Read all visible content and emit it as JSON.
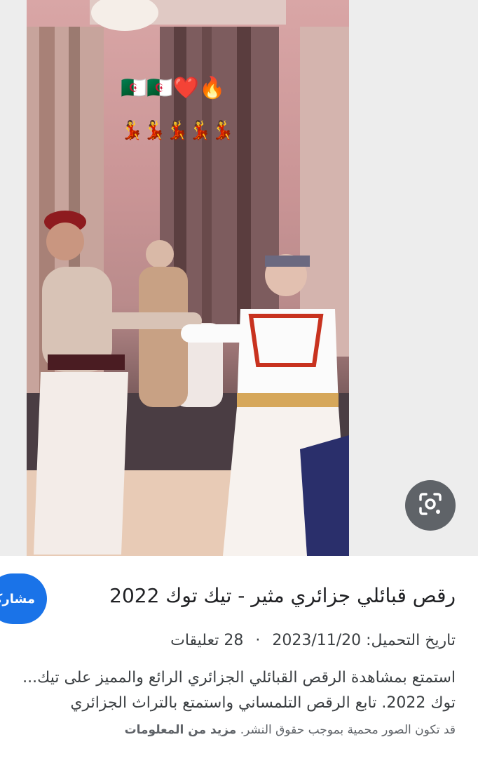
{
  "result": {
    "title": "رقص قبائلي جزائري مثير - تيك توك 2022",
    "upload_label": "تاريخ التحميل:",
    "upload_date": "2023/11/20",
    "separator": "·",
    "comments": "28 تعليقات",
    "description_line1": "استمتع بمشاهدة الرقص القبائلي الجزائري الرائع والمميز على تيك...",
    "description_line2": "توك 2022. تابع الرقص التلمساني واستمتع بالتراث الجزائري",
    "copyright_notice": "قد تكون الصور محمية بموجب حقوق النشر.",
    "more_info": "مزيد من المعلومات"
  },
  "actions": {
    "share_label": "مشاركة"
  },
  "overlay_emojis": {
    "row1": "🇩🇿🇩🇿❤️🔥",
    "row2": "💃💃💃💃💃"
  },
  "icons": {
    "lens": "camera-search-icon"
  },
  "colors": {
    "accent": "#1a73e8",
    "lens_button": "#5f6368"
  }
}
